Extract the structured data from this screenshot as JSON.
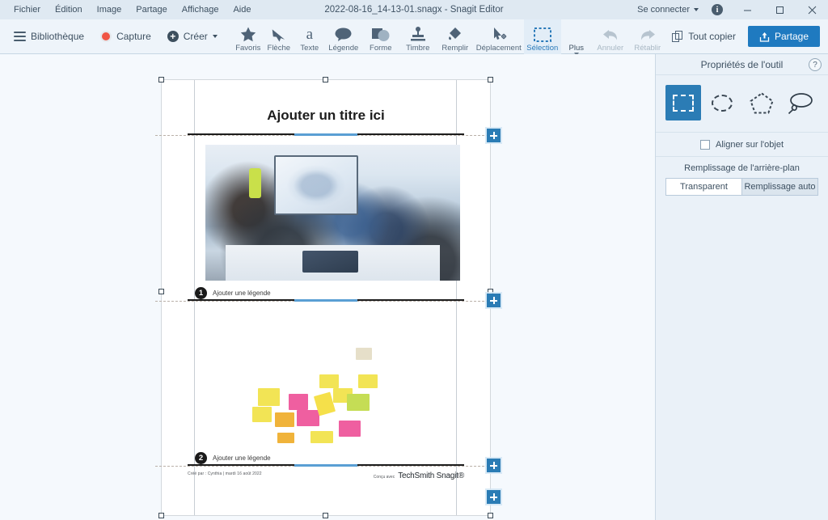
{
  "window": {
    "title": "2022-08-16_14-13-01.snagx - Snagit Editor",
    "menus": [
      "Fichier",
      "Édition",
      "Image",
      "Partage",
      "Affichage",
      "Aide"
    ],
    "signin_label": "Se connecter",
    "info_glyph": "i",
    "minimize_glyph": "—",
    "maximize_glyph": "▢",
    "close_glyph": "✕",
    "accent_color": "#1f7ac0",
    "titlebar_color": "#dfe9f2"
  },
  "toolbar": {
    "library_label": "Bibliothèque",
    "capture_label": "Capture",
    "create_label": "Créer",
    "copy_all_label": "Tout copier",
    "share_label": "Partage",
    "tools": [
      {
        "name": "favorites",
        "label": "Favoris",
        "glyph": "★",
        "active": false,
        "disabled": false
      },
      {
        "name": "arrow",
        "label": "Flèche",
        "glyph": "↖",
        "active": false,
        "disabled": false
      },
      {
        "name": "text",
        "label": "Texte",
        "glyph": "a",
        "active": false,
        "disabled": false
      },
      {
        "name": "callout",
        "label": "Légende",
        "glyph": "●",
        "active": false,
        "disabled": false
      },
      {
        "name": "shape",
        "label": "Forme",
        "glyph": "◧",
        "active": false,
        "disabled": false
      },
      {
        "name": "stamp",
        "label": "Timbre",
        "glyph": "⬍",
        "active": false,
        "disabled": false
      },
      {
        "name": "fill",
        "label": "Remplir",
        "glyph": "◣",
        "active": false,
        "disabled": false
      },
      {
        "name": "move",
        "label": "Déplacement",
        "glyph": "✥",
        "active": false,
        "disabled": false
      },
      {
        "name": "selection",
        "label": "Sélection",
        "glyph": "▭",
        "active": true,
        "disabled": false
      },
      {
        "name": "more",
        "label": "Plus",
        "glyph": "▾",
        "active": false,
        "disabled": false
      },
      {
        "name": "undo",
        "label": "Annuler",
        "glyph": "↰",
        "active": false,
        "disabled": true
      },
      {
        "name": "redo",
        "label": "Rétablir",
        "glyph": "↱",
        "active": false,
        "disabled": true
      }
    ]
  },
  "document": {
    "title": "Ajouter un titre ici",
    "sections": [
      {
        "number": "1",
        "caption": "Ajouter une légende"
      },
      {
        "number": "2",
        "caption": "Ajouter une légende"
      }
    ],
    "footer_left": "Créé par : Cynthia   |   mardi 16 août 2022",
    "footer_right_label": "Conçu avec",
    "footer_right_brand": "TechSmith Snagit®",
    "add_button_glyph": "+"
  },
  "panel": {
    "header": "Propriétés de l'outil",
    "help_glyph": "?",
    "shapes": [
      {
        "name": "rectangle-selection",
        "selected": true
      },
      {
        "name": "ellipse-selection",
        "selected": false
      },
      {
        "name": "polygon-selection",
        "selected": false
      },
      {
        "name": "lasso-selection",
        "selected": false
      }
    ],
    "snap_label": "Aligner sur l'objet",
    "snap_checked": false,
    "fill_section_label": "Remplissage de l'arrière-plan",
    "fill_options": [
      "Transparent",
      "Remplissage auto"
    ],
    "fill_selected": "Transparent"
  }
}
